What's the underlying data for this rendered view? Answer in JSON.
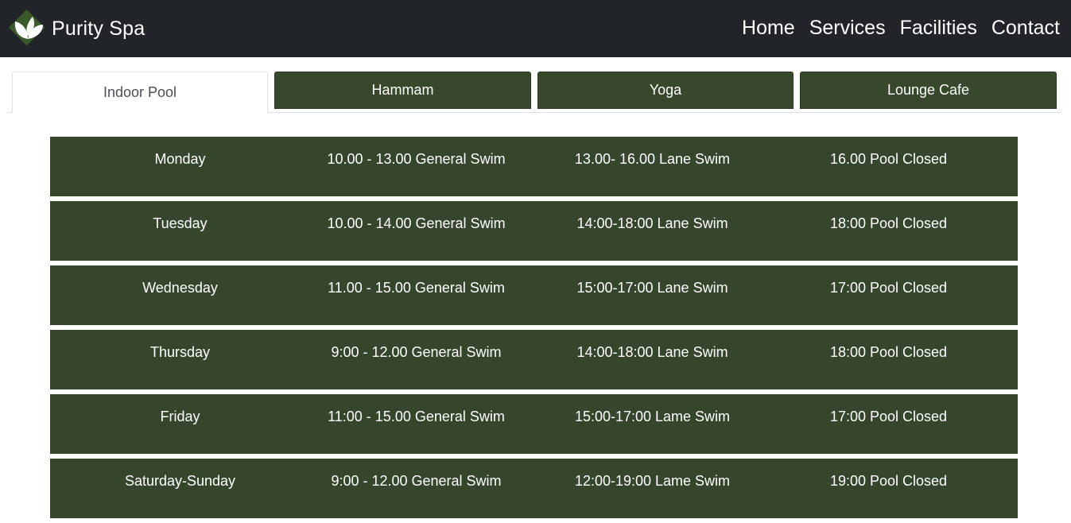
{
  "header": {
    "brand": "Purity Spa",
    "nav": [
      "Home",
      "Services",
      "Facilities",
      "Contact"
    ]
  },
  "tabs": [
    {
      "label": "Indoor Pool",
      "active": true
    },
    {
      "label": "Hammam",
      "active": false
    },
    {
      "label": "Yoga",
      "active": false
    },
    {
      "label": "Lounge Cafe",
      "active": false
    }
  ],
  "schedule": [
    [
      "Monday",
      "10.00 - 13.00 General Swim",
      "13.00- 16.00 Lane Swim",
      "16.00 Pool Closed"
    ],
    [
      "Tuesday",
      "10.00 - 14.00 General Swim",
      "14:00-18:00 Lane Swim",
      "18:00 Pool Closed"
    ],
    [
      "Wednesday",
      "11.00 - 15.00 General Swim",
      "15:00-17:00 Lane Swim",
      "17:00 Pool Closed"
    ],
    [
      "Thursday",
      "9:00 - 12.00 General Swim",
      "14:00-18:00 Lane Swim",
      "18:00 Pool Closed"
    ],
    [
      "Friday",
      "11:00 - 15.00 General Swim",
      "15:00-17:00 Lame Swim",
      "17:00 Pool Closed"
    ],
    [
      "Saturday-Sunday",
      "9:00 - 12.00 General Swim",
      "12:00-19:00 Lame Swim",
      "19:00 Pool Closed"
    ]
  ],
  "colors": {
    "navbar": "#212529",
    "accent": "#36462d",
    "tab_inactive": "#38482c",
    "logo_leaf_dark": "#3b5a2b"
  },
  "icons": {
    "logo": "leaf-logo-icon"
  }
}
